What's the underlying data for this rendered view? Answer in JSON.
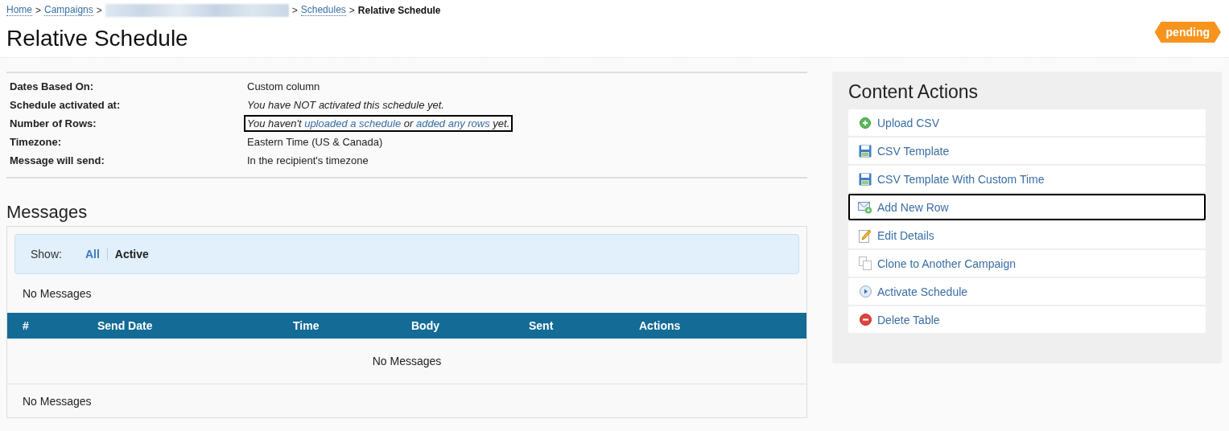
{
  "breadcrumb": [
    {
      "kind": "link",
      "label": "Home"
    },
    {
      "kind": "separator",
      "label": ">"
    },
    {
      "kind": "link",
      "label": "Campaigns"
    },
    {
      "kind": "separator",
      "label": ">"
    },
    {
      "kind": "redacted"
    },
    {
      "kind": "separator",
      "label": ">"
    },
    {
      "kind": "link",
      "label": "Schedules"
    },
    {
      "kind": "separator",
      "label": ">"
    },
    {
      "kind": "current",
      "label": "Relative Schedule"
    }
  ],
  "page": {
    "title": "Relative Schedule",
    "status": "pending"
  },
  "details": [
    {
      "label": "Dates Based On:",
      "italic": false,
      "outlined": false,
      "value": [
        {
          "text": "Custom column",
          "kind": "text"
        }
      ]
    },
    {
      "label": "Schedule activated at:",
      "italic": true,
      "outlined": false,
      "value": [
        {
          "text": "You have NOT activated this schedule yet.",
          "kind": "text"
        }
      ]
    },
    {
      "label": "Number of Rows:",
      "italic": true,
      "outlined": true,
      "value": [
        {
          "text": "You haven't ",
          "kind": "text"
        },
        {
          "text": "uploaded a schedule",
          "kind": "link"
        },
        {
          "text": " or ",
          "kind": "text"
        },
        {
          "text": "added any rows",
          "kind": "link"
        },
        {
          "text": " yet.",
          "kind": "text"
        }
      ]
    },
    {
      "label": "Timezone:",
      "italic": false,
      "outlined": false,
      "value": [
        {
          "text": "Eastern Time (US & Canada)",
          "kind": "text"
        }
      ]
    },
    {
      "label": "Message will send:",
      "italic": false,
      "outlined": false,
      "value": [
        {
          "text": "In the recipient's timezone",
          "kind": "text"
        }
      ]
    }
  ],
  "messages": {
    "title": "Messages",
    "filter_label": "Show:",
    "filters": [
      {
        "label": "All",
        "selected": false
      },
      {
        "label": "Active",
        "selected": true
      }
    ],
    "summary_top": "No Messages",
    "columns": [
      "#",
      "Send Date",
      "Time",
      "Body",
      "Sent",
      "Actions"
    ],
    "empty_text": "No Messages",
    "summary_bottom": "No Messages"
  },
  "content_actions": {
    "title": "Content Actions",
    "items": [
      {
        "kind": "upload",
        "label": "Upload CSV",
        "outlined": false
      },
      {
        "kind": "template",
        "label": "CSV Template",
        "outlined": false
      },
      {
        "kind": "template",
        "label": "CSV Template With Custom Time",
        "outlined": false
      },
      {
        "kind": "add",
        "label": "Add New Row",
        "outlined": true
      },
      {
        "kind": "edit",
        "label": "Edit Details",
        "outlined": false
      },
      {
        "kind": "clone",
        "label": "Clone to Another Campaign",
        "outlined": false
      },
      {
        "kind": "activate",
        "label": "Activate Schedule",
        "outlined": false
      },
      {
        "kind": "delete",
        "label": "Delete Table",
        "outlined": false
      }
    ]
  }
}
